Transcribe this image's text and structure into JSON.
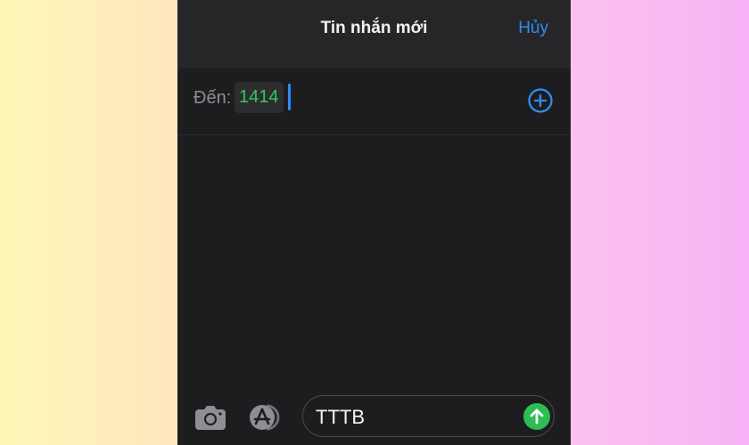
{
  "header": {
    "title": "Tin nhắn mới",
    "cancel_label": "Hủy"
  },
  "recipient": {
    "to_label": "Đến:",
    "value": "1414"
  },
  "message": {
    "text": "TTTB"
  },
  "icons": {
    "add_contact": "plus-circle-icon",
    "camera": "camera-icon",
    "apps": "app-store-icon",
    "send": "send-arrow-icon"
  },
  "colors": {
    "accent_blue": "#2f8cf5",
    "recipient_green": "#34c759",
    "send_green": "#2dbd52",
    "background_dark": "#1d1d1f"
  }
}
